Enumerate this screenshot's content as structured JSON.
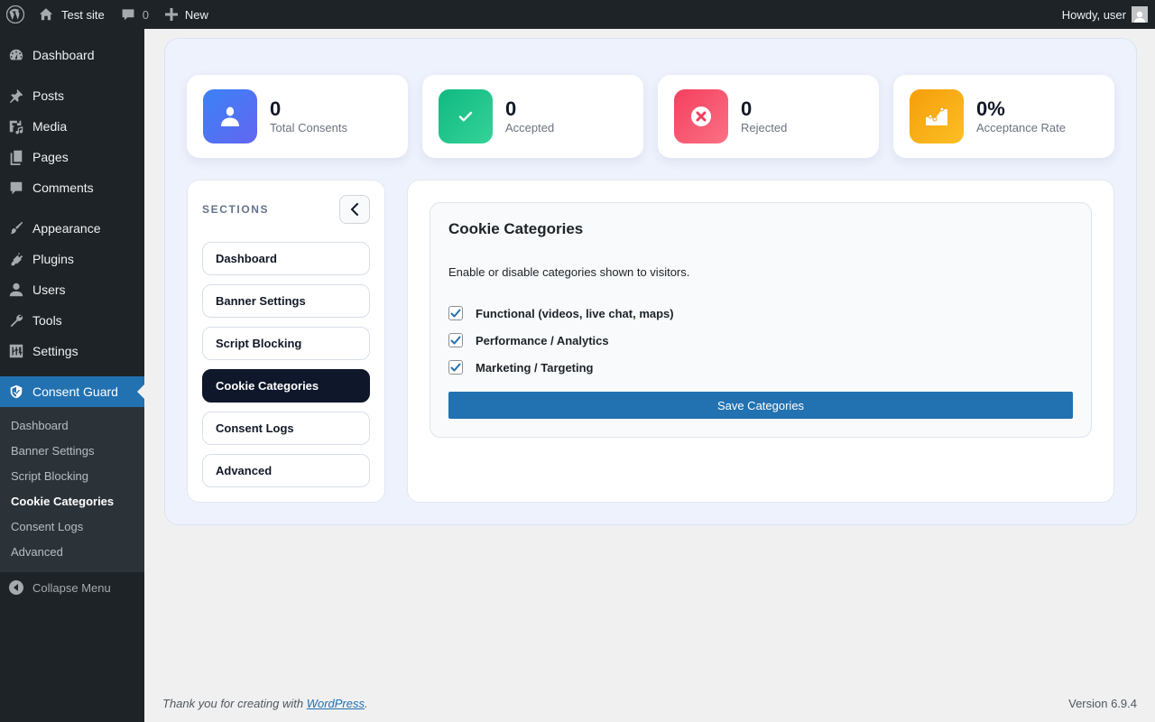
{
  "adminbar": {
    "site_name": "Test site",
    "comments_count": "0",
    "new_label": "New",
    "howdy": "Howdy, user"
  },
  "sidebar": {
    "items": [
      {
        "label": "Dashboard",
        "icon": "dashboard-icon"
      },
      {
        "label": "Posts",
        "icon": "pin-icon"
      },
      {
        "label": "Media",
        "icon": "media-icon"
      },
      {
        "label": "Pages",
        "icon": "pages-icon"
      },
      {
        "label": "Comments",
        "icon": "comment-icon"
      },
      {
        "label": "Appearance",
        "icon": "brush-icon"
      },
      {
        "label": "Plugins",
        "icon": "plug-icon"
      },
      {
        "label": "Users",
        "icon": "user-icon"
      },
      {
        "label": "Tools",
        "icon": "wrench-icon"
      },
      {
        "label": "Settings",
        "icon": "sliders-icon"
      },
      {
        "label": "Consent Guard",
        "icon": "shield-icon"
      }
    ],
    "submenu": [
      "Dashboard",
      "Banner Settings",
      "Script Blocking",
      "Cookie Categories",
      "Consent Logs",
      "Advanced"
    ],
    "submenu_current": "Cookie Categories",
    "collapse_label": "Collapse Menu"
  },
  "stats": [
    {
      "value": "0",
      "label": "Total Consents",
      "color_from": "#3b82f6",
      "color_to": "#6366f1",
      "icon": "user-icon"
    },
    {
      "value": "0",
      "label": "Accepted",
      "color_from": "#10b981",
      "color_to": "#34d399",
      "icon": "check-icon"
    },
    {
      "value": "0",
      "label": "Rejected",
      "color_from": "#f43f5e",
      "color_to": "#fb7185",
      "icon": "x-circle-icon"
    },
    {
      "value": "0%",
      "label": "Acceptance Rate",
      "color_from": "#f59e0b",
      "color_to": "#fbbf24",
      "icon": "chart-icon"
    }
  ],
  "sections": {
    "title": "SECTIONS",
    "items": [
      "Dashboard",
      "Banner Settings",
      "Script Blocking",
      "Cookie Categories",
      "Consent Logs",
      "Advanced"
    ],
    "active": "Cookie Categories"
  },
  "categories": {
    "title": "Cookie Categories",
    "description": "Enable or disable categories shown to visitors.",
    "options": [
      {
        "label": "Functional (videos, live chat, maps)",
        "checked": true
      },
      {
        "label": "Performance / Analytics",
        "checked": true
      },
      {
        "label": "Marketing / Targeting",
        "checked": true
      }
    ],
    "save_label": "Save Categories"
  },
  "footer": {
    "thanks_prefix": "Thank you for creating with ",
    "thanks_link": "WordPress",
    "thanks_suffix": ".",
    "version": "Version 6.9.4"
  }
}
